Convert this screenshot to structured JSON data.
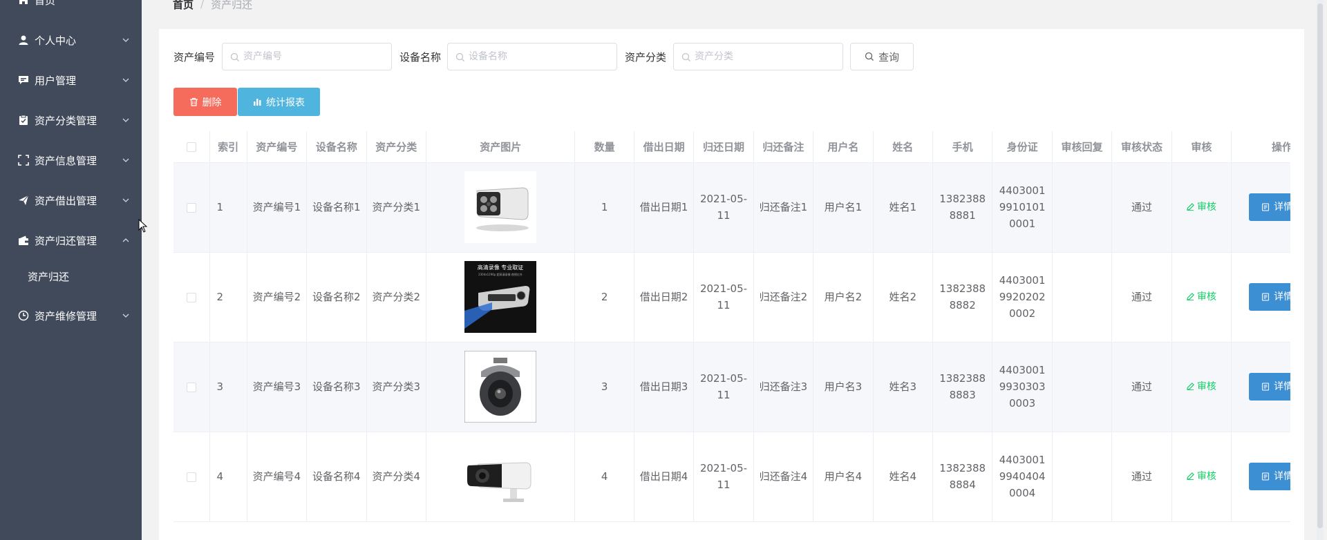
{
  "breadcrumb": {
    "home": "首页",
    "separator": "/",
    "current": "资产归还"
  },
  "sidebar": {
    "top_item": "首页",
    "items": [
      {
        "label": "个人中心",
        "icon": "user-icon",
        "expanded": false
      },
      {
        "label": "用户管理",
        "icon": "chat-icon",
        "expanded": false
      },
      {
        "label": "资产分类管理",
        "icon": "clipboard-icon",
        "expanded": false
      },
      {
        "label": "资产信息管理",
        "icon": "crop-icon",
        "expanded": false
      },
      {
        "label": "资产借出管理",
        "icon": "send-icon",
        "expanded": false
      },
      {
        "label": "资产归还管理",
        "icon": "wallet-icon",
        "expanded": true
      },
      {
        "label": "资产维修管理",
        "icon": "clock-icon",
        "expanded": false
      }
    ],
    "sub_item": "资产归还"
  },
  "filters": {
    "asset_no": {
      "label": "资产编号",
      "placeholder": "资产编号"
    },
    "device_name": {
      "label": "设备名称",
      "placeholder": "设备名称"
    },
    "asset_category": {
      "label": "资产分类",
      "placeholder": "资产分类"
    },
    "query_label": "查询"
  },
  "actions": {
    "delete_label": "删除",
    "report_label": "统计报表"
  },
  "table": {
    "headers": [
      "索引",
      "资产编号",
      "设备名称",
      "资产分类",
      "资产图片",
      "数量",
      "借出日期",
      "归还日期",
      "归还备注",
      "用户名",
      "姓名",
      "手机",
      "身份证",
      "审核回复",
      "审核状态",
      "审核",
      "操作"
    ],
    "review_label": "审核",
    "detail_label": "详情",
    "rows": [
      {
        "index": "1",
        "asset_no": "资产编号1",
        "device": "设备名称1",
        "category": "资产分类1",
        "image": "bullet-camera",
        "qty": "1",
        "lend_date": "借出日期1",
        "return_date": "2021-05-11",
        "return_note": "归还备注1",
        "username": "用户名1",
        "name": "姓名1",
        "phone": "13823888881",
        "id_card": "440300199101010001",
        "reply": "",
        "status": "通过"
      },
      {
        "index": "2",
        "asset_no": "资产编号2",
        "device": "设备名称2",
        "category": "资产分类2",
        "image": "recorder-camera",
        "qty": "2",
        "lend_date": "借出日期2",
        "return_date": "2021-05-11",
        "return_note": "归还备注2",
        "username": "用户名2",
        "name": "姓名2",
        "phone": "13823888882",
        "id_card": "440300199202020002",
        "reply": "",
        "status": "通过"
      },
      {
        "index": "3",
        "asset_no": "资产编号3",
        "device": "设备名称3",
        "category": "资产分类3",
        "image": "dome-camera",
        "qty": "3",
        "lend_date": "借出日期3",
        "return_date": "2021-05-11",
        "return_note": "归还备注3",
        "username": "用户名3",
        "name": "姓名3",
        "phone": "13823888883",
        "id_card": "440300199303030003",
        "reply": "",
        "status": "通过"
      },
      {
        "index": "4",
        "asset_no": "资产编号4",
        "device": "设备名称4",
        "category": "资产分类4",
        "image": "bullet-camera-black",
        "qty": "4",
        "lend_date": "借出日期4",
        "return_date": "2021-05-11",
        "return_note": "归还备注4",
        "username": "用户名4",
        "name": "姓名4",
        "phone": "13823888884",
        "id_card": "440300199404040004",
        "reply": "",
        "status": "通过"
      }
    ]
  },
  "recorder_image": {
    "line1": "高清录像 专业取证",
    "line2": "2304x1296p 超高清录像 夜视红外"
  },
  "colors": {
    "sidebar_bg": "#414a5b",
    "delete_btn": "#f56c5c",
    "report_btn": "#4fb5de",
    "detail_btn": "#3d8fd4",
    "review_link": "#13ce66"
  }
}
